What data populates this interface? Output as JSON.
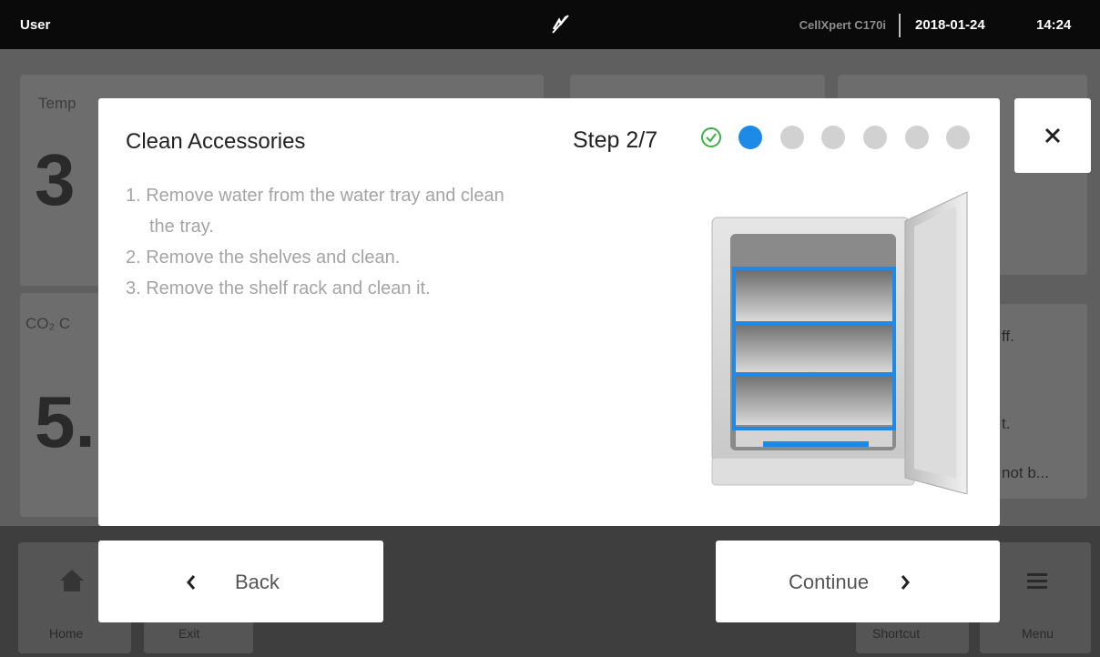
{
  "status_bar": {
    "user": "User",
    "device": "CellXpert C170i",
    "date": "2018-01-24",
    "time": "14:24",
    "icon": "no-connection-icon"
  },
  "background": {
    "temperature_label": "Temp",
    "temperature_value": "3",
    "co2_label": "CO₂ C",
    "co2_value": "5.",
    "right_texts": [
      "ff.",
      "t.",
      "not b..."
    ],
    "nav": [
      {
        "label": "Home",
        "icon": "home-icon"
      },
      {
        "label": "Exit"
      },
      {
        "label": "Shortcut"
      },
      {
        "label": "Menu",
        "icon": "menu-icon"
      }
    ]
  },
  "dialog": {
    "title": "Clean Accessories",
    "step_label": "Step 2/7",
    "steps_total": 7,
    "current_step": 2,
    "instructions": [
      "1. Remove water from the water tray and clean",
      "the tray.",
      "2. Remove the shelves and clean.",
      "3. Remove the shelf rack and clean it."
    ],
    "illustration": "incubator-open-door-illustration",
    "accent_color": "#1d8ae8",
    "done_color": "#3cb043"
  },
  "buttons": {
    "back": "Back",
    "continue": "Continue",
    "close_icon": "close-icon"
  }
}
